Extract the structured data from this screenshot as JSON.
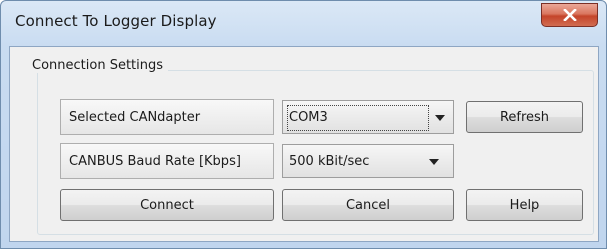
{
  "window": {
    "title": "Connect To Logger Display",
    "close_icon": "close-icon"
  },
  "connection_settings": {
    "legend": "Connection Settings",
    "candapter_label": "Selected CANdapter",
    "candapter_value": "COM3",
    "baud_label": "CANBUS Baud Rate [Kbps]",
    "baud_value": "500 kBit/sec",
    "refresh_label": "Refresh"
  },
  "actions": {
    "connect_label": "Connect",
    "cancel_label": "Cancel",
    "help_label": "Help"
  },
  "colors": {
    "titlebar": "#c9dcf1",
    "close_button": "#c4452a",
    "client_background": "#f0f0f0"
  }
}
